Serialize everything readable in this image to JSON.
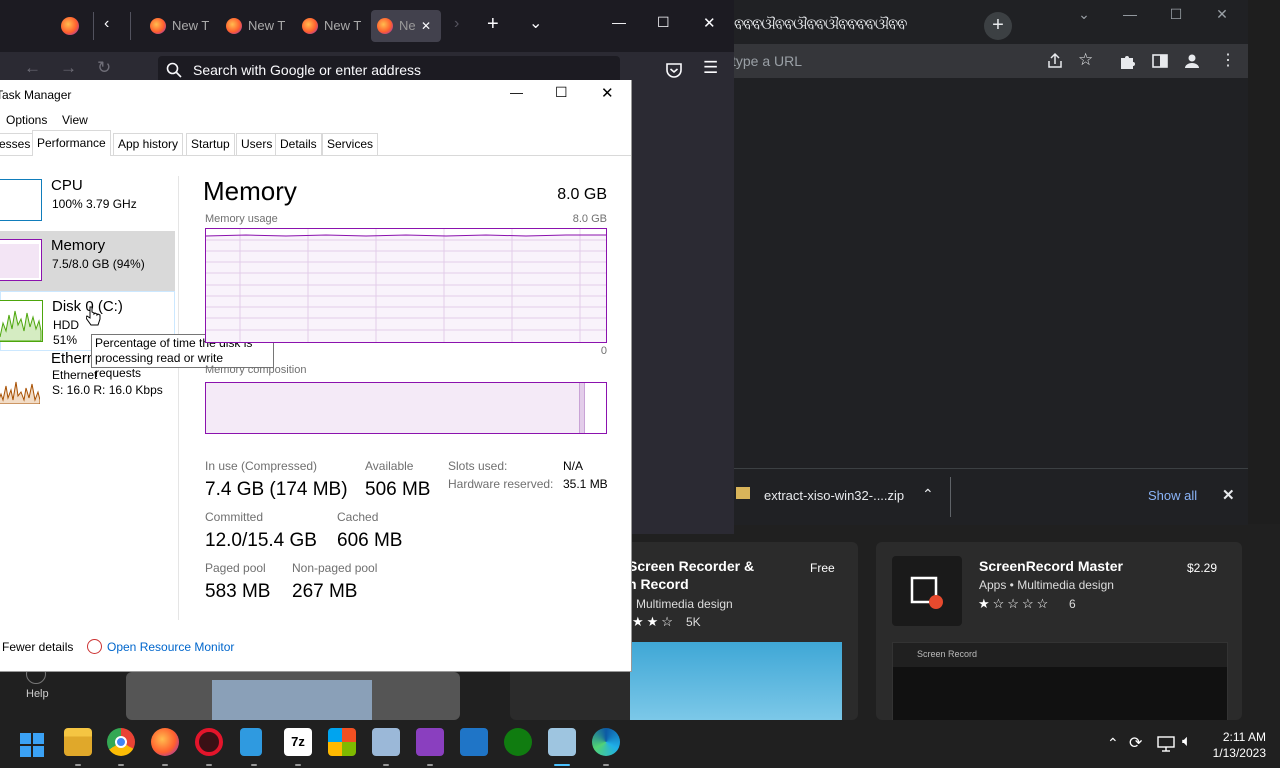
{
  "firefox": {
    "tabs": [
      {
        "label": "New T"
      },
      {
        "label": "New T"
      },
      {
        "label": "New T"
      },
      {
        "label": "Ne"
      }
    ],
    "urlbar_placeholder": "Search with Google or enter address"
  },
  "chrome": {
    "omnibox_placeholder": "type a URL",
    "download_filename": "extract-xiso-win32-....zip",
    "show_all_label": "Show all"
  },
  "store": {
    "card1": {
      "title_line1": "Screen Recorder &",
      "title_line2": "n Record",
      "category": "Multimedia design",
      "rating_count": "5K",
      "price": "Free"
    },
    "card2": {
      "title": "ScreenRecord Master",
      "category": "Apps • Multimedia design",
      "rating_count": "6",
      "price": "$2.29",
      "preview_title": "Screen Record"
    },
    "help_label": "Help"
  },
  "taskmanager": {
    "title": "Task Manager",
    "menu": [
      "Options",
      "View"
    ],
    "tabs": [
      "esses",
      "Performance",
      "App history",
      "Startup",
      "Users",
      "Details",
      "Services"
    ],
    "sidebar": [
      {
        "name": "CPU",
        "sub1": "100%  3.79 GHz",
        "sub2": ""
      },
      {
        "name": "Memory",
        "sub1": "7.5/8.0 GB (94%)",
        "sub2": ""
      },
      {
        "name": "Disk 0 (C:)",
        "sub1": "HDD",
        "sub2": "51%"
      },
      {
        "name": "Ethernet",
        "sub1": "Ethernet",
        "sub2": "S: 16.0  R: 16.0 Kbps"
      }
    ],
    "tooltip_line1": "Percentage of time the disk is",
    "tooltip_line2": "processing read or write requests",
    "main": {
      "heading": "Memory",
      "total": "8.0 GB",
      "usage_label": "Memory usage",
      "usage_max": "8.0 GB",
      "usage_min": "0",
      "composition_label": "Memory composition",
      "stats": {
        "in_use_label": "In use (Compressed)",
        "in_use_value": "7.4 GB (174 MB)",
        "available_label": "Available",
        "available_value": "506 MB",
        "committed_label": "Committed",
        "committed_value": "12.0/15.4 GB",
        "cached_label": "Cached",
        "cached_value": "606 MB",
        "paged_label": "Paged pool",
        "paged_value": "583 MB",
        "nonpaged_label": "Non-paged pool",
        "nonpaged_value": "267 MB",
        "slots_label": "Slots used:",
        "slots_value": "N/A",
        "hwres_label": "Hardware reserved:",
        "hwres_value": "35.1 MB"
      }
    },
    "footer": {
      "fewer_details": "Fewer details",
      "open_monitor": "Open Resource Monitor"
    }
  },
  "taskbar": {
    "time": "2:11 AM",
    "date": "1/13/2023"
  },
  "colors": {
    "memory_accent": "#8b12ae",
    "cpu_accent": "#117dbb",
    "disk_accent": "#4da60c",
    "ethernet_accent": "#a74f01"
  }
}
